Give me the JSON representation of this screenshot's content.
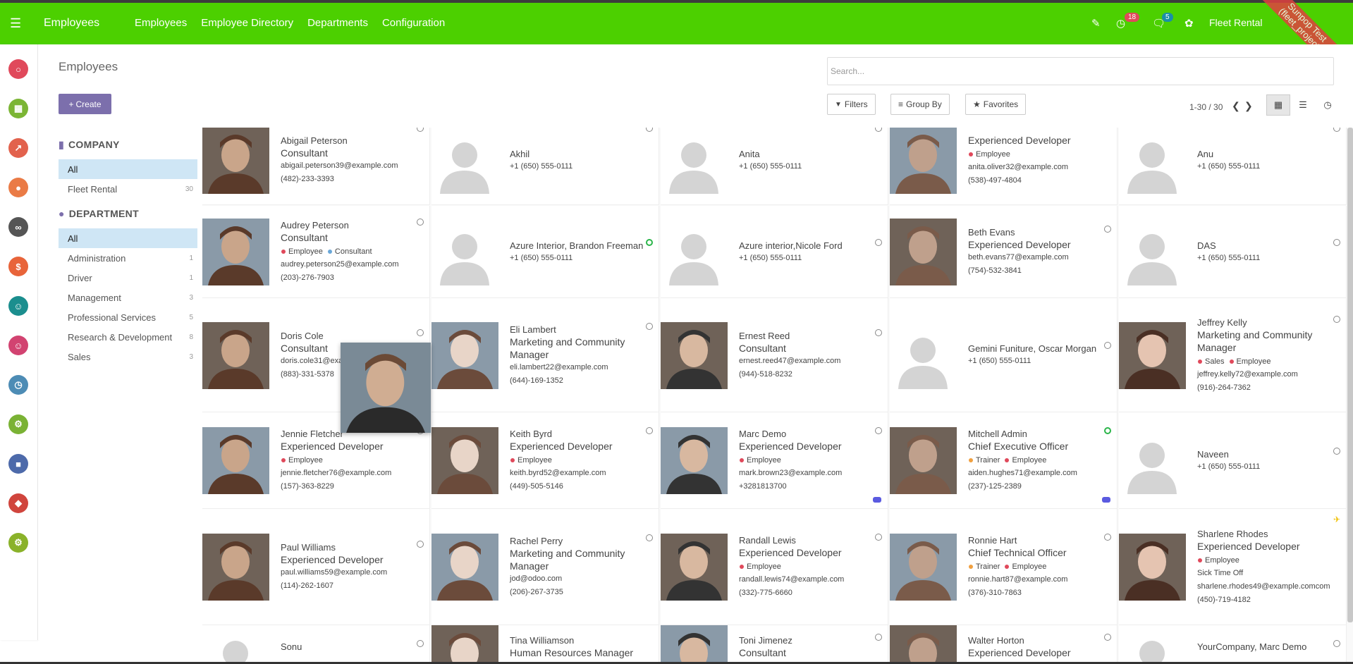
{
  "navbar": {
    "app_name": "Employees",
    "menu": [
      "Employees",
      "Employee Directory",
      "Departments",
      "Configuration"
    ],
    "activity_count": "18",
    "message_count": "5",
    "company": "Fleet Rental",
    "ribbon": "Sunpop Test\n(fleet_project)",
    "accent": "#4cd000"
  },
  "apps": [
    {
      "icon": "discuss-icon",
      "color": "#e0495b"
    },
    {
      "icon": "calendar-icon",
      "color": "#7bb534"
    },
    {
      "icon": "dashboard-icon",
      "color": "#e2624d"
    },
    {
      "icon": "website-icon",
      "color": "#ea7b46"
    },
    {
      "icon": "link-icon",
      "color": "#555555"
    },
    {
      "icon": "invoicing-icon",
      "color": "#e8643a"
    },
    {
      "icon": "employees-icon",
      "color": "#1b8e8e"
    },
    {
      "icon": "recruitment-icon",
      "color": "#d24371"
    },
    {
      "icon": "timeoff-icon",
      "color": "#4d8cb5"
    },
    {
      "icon": "expenses-icon",
      "color": "#7ab234"
    },
    {
      "icon": "fleet-icon",
      "color": "#4d6aaa"
    },
    {
      "icon": "apps-icon",
      "color": "#d0453d"
    },
    {
      "icon": "settings-icon",
      "color": "#8ab22a"
    }
  ],
  "control_panel": {
    "title": "Employees",
    "create_label": "Create",
    "search_placeholder": "Search...",
    "filters_label": "Filters",
    "groupby_label": "Group By",
    "favorites_label": "Favorites",
    "pager": "1-30 / 30"
  },
  "sidebar": {
    "company_header": "COMPANY",
    "company_items": [
      {
        "label": "All",
        "count": ""
      },
      {
        "label": "Fleet Rental",
        "count": "30"
      }
    ],
    "department_header": "DEPARTMENT",
    "department_items": [
      {
        "label": "All",
        "count": ""
      },
      {
        "label": "Administration",
        "count": "1"
      },
      {
        "label": "Driver",
        "count": "1"
      },
      {
        "label": "Management",
        "count": "3"
      },
      {
        "label": "Professional Services",
        "count": "5"
      },
      {
        "label": "Research & Development",
        "count": "8"
      },
      {
        "label": "Sales",
        "count": "3"
      }
    ]
  },
  "employees": [
    {
      "name": "Abigail Peterson",
      "job": "Consultant",
      "tags": [],
      "email": "abigail.peterson39@example.com",
      "phone": "(482)-233-3393",
      "photo": true,
      "status": "off"
    },
    {
      "name": "Akhil",
      "job": "",
      "tags": [],
      "email": "",
      "phone": "+1 (650) 555-0111",
      "photo": false,
      "status": "off"
    },
    {
      "name": "Anita",
      "job": "",
      "tags": [],
      "email": "",
      "phone": "+1 (650) 555-0111",
      "photo": false,
      "status": "off"
    },
    {
      "name": "",
      "job": "Experienced Developer",
      "tags": [
        {
          "label": "Employee",
          "color": "#e0495b"
        }
      ],
      "email": "anita.oliver32@example.com",
      "phone": "(538)-497-4804",
      "photo": true,
      "status": "none"
    },
    {
      "name": "Anu",
      "job": "",
      "tags": [],
      "email": "",
      "phone": "+1 (650) 555-0111",
      "photo": false,
      "status": "off"
    },
    {
      "name": "Audrey Peterson",
      "job": "Consultant",
      "tags": [
        {
          "label": "Employee",
          "color": "#e0495b"
        },
        {
          "label": "Consultant",
          "color": "#6aa7d8"
        }
      ],
      "email": "audrey.peterson25@example.com",
      "phone": "(203)-276-7903",
      "photo": true,
      "status": "off"
    },
    {
      "name": "Azure Interior, Brandon Freeman",
      "job": "",
      "tags": [],
      "email": "",
      "phone": "+1 (650) 555-0111",
      "photo": false,
      "status": "on"
    },
    {
      "name": "Azure interior,Nicole Ford",
      "job": "",
      "tags": [],
      "email": "",
      "phone": "+1 (650) 555-0111",
      "photo": false,
      "status": "off"
    },
    {
      "name": "Beth Evans",
      "job": "Experienced Developer",
      "tags": [],
      "email": "beth.evans77@example.com",
      "phone": "(754)-532-3841",
      "photo": true,
      "status": "off"
    },
    {
      "name": "DAS",
      "job": "",
      "tags": [],
      "email": "",
      "phone": "+1 (650) 555-0111",
      "photo": false,
      "status": "off"
    },
    {
      "name": "Doris Cole",
      "job": "Consultant",
      "tags": [],
      "email": "doris.cole31@example.com",
      "phone": "(883)-331-5378",
      "photo": true,
      "status": "off"
    },
    {
      "name": "Eli Lambert",
      "job": "Marketing and Community Manager",
      "tags": [],
      "email": "eli.lambert22@example.com",
      "phone": "(644)-169-1352",
      "photo": true,
      "status": "off"
    },
    {
      "name": "Ernest Reed",
      "job": "Consultant",
      "tags": [],
      "email": "ernest.reed47@example.com",
      "phone": "(944)-518-8232",
      "photo": true,
      "status": "off"
    },
    {
      "name": "Gemini Funiture, Oscar Morgan",
      "job": "",
      "tags": [],
      "email": "",
      "phone": "+1 (650) 555-0111",
      "photo": false,
      "status": "off"
    },
    {
      "name": "Jeffrey Kelly",
      "job": "Marketing and Community Manager",
      "tags": [
        {
          "label": "Sales",
          "color": "#e0495b"
        },
        {
          "label": "Employee",
          "color": "#e0495b"
        }
      ],
      "email": "jeffrey.kelly72@example.com",
      "phone": "(916)-264-7362",
      "photo": true,
      "status": "off"
    },
    {
      "name": "Jennie Fletcher",
      "job": "Experienced Developer",
      "tags": [
        {
          "label": "Employee",
          "color": "#e0495b"
        }
      ],
      "email": "jennie.fletcher76@example.com",
      "phone": "(157)-363-8229",
      "photo": true,
      "status": "off"
    },
    {
      "name": "Keith Byrd",
      "job": "Experienced Developer",
      "tags": [
        {
          "label": "Employee",
          "color": "#e0495b"
        }
      ],
      "email": "keith.byrd52@example.com",
      "phone": "(449)-505-5146",
      "photo": true,
      "status": "off"
    },
    {
      "name": "Marc Demo",
      "job": "Experienced Developer",
      "tags": [
        {
          "label": "Employee",
          "color": "#e0495b"
        }
      ],
      "email": "mark.brown23@example.com",
      "phone": "+3281813700",
      "photo": true,
      "status": "off",
      "comment": true
    },
    {
      "name": "Mitchell Admin",
      "job": "Chief Executive Officer",
      "tags": [
        {
          "label": "Trainer",
          "color": "#f0a040"
        },
        {
          "label": "Employee",
          "color": "#e0495b"
        }
      ],
      "email": "aiden.hughes71@example.com",
      "phone": "(237)-125-2389",
      "photo": true,
      "status": "on",
      "comment": true
    },
    {
      "name": "Naveen",
      "job": "",
      "tags": [],
      "email": "",
      "phone": "+1 (650) 555-0111",
      "photo": false,
      "status": "off"
    },
    {
      "name": "Paul Williams",
      "job": "Experienced Developer",
      "tags": [],
      "email": "paul.williams59@example.com",
      "phone": "(114)-262-1607",
      "photo": true,
      "status": "off"
    },
    {
      "name": "Rachel Perry",
      "job": "Marketing and Community Manager",
      "tags": [],
      "email": "jod@odoo.com",
      "phone": "(206)-267-3735",
      "photo": true,
      "status": "off"
    },
    {
      "name": "Randall Lewis",
      "job": "Experienced Developer",
      "tags": [
        {
          "label": "Employee",
          "color": "#e0495b"
        }
      ],
      "email": "randall.lewis74@example.com",
      "phone": "(332)-775-6660",
      "photo": true,
      "status": "off"
    },
    {
      "name": "Ronnie Hart",
      "job": "Chief Technical Officer",
      "tags": [
        {
          "label": "Trainer",
          "color": "#f0a040"
        },
        {
          "label": "Employee",
          "color": "#e0495b"
        }
      ],
      "email": "ronnie.hart87@example.com",
      "phone": "(376)-310-7863",
      "photo": true,
      "status": "off"
    },
    {
      "name": "Sharlene Rhodes",
      "job": "Experienced Developer",
      "tags": [
        {
          "label": "Employee",
          "color": "#e0495b"
        }
      ],
      "extra": "Sick Time Off",
      "email": "sharlene.rhodes49@example.comcom",
      "phone": "(450)-719-4182",
      "photo": true,
      "status": "away"
    },
    {
      "name": "Sonu",
      "job": "",
      "tags": [],
      "email": "",
      "phone": "",
      "photo": false,
      "status": "off"
    },
    {
      "name": "Tina Williamson",
      "job": "Human Resources Manager",
      "tags": [],
      "email": "",
      "phone": "",
      "photo": true,
      "status": "none"
    },
    {
      "name": "Toni Jimenez",
      "job": "Consultant",
      "tags": [],
      "email": "",
      "phone": "",
      "photo": true,
      "status": "off"
    },
    {
      "name": "Walter Horton",
      "job": "Experienced Developer",
      "tags": [],
      "email": "",
      "phone": "",
      "photo": true,
      "status": "off"
    },
    {
      "name": "YourCompany, Marc Demo",
      "job": "",
      "tags": [],
      "email": "",
      "phone": "",
      "photo": false,
      "status": "off"
    }
  ]
}
